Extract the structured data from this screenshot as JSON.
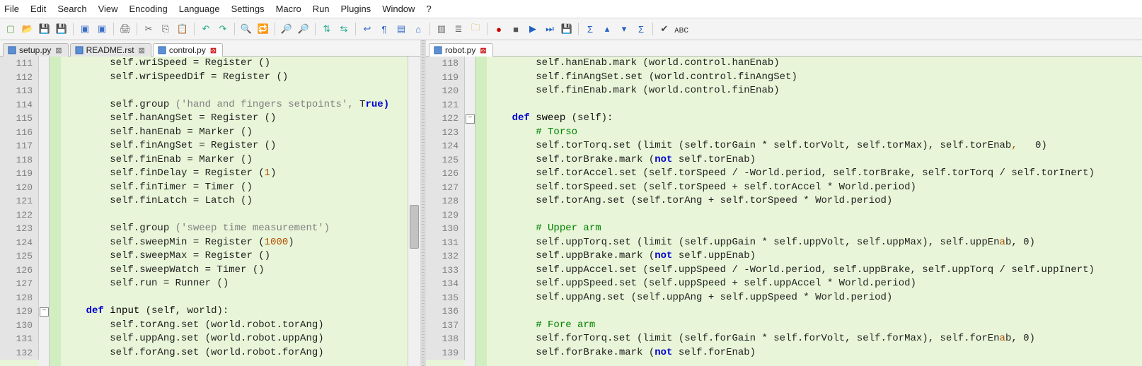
{
  "menu": [
    "File",
    "Edit",
    "Search",
    "View",
    "Encoding",
    "Language",
    "Settings",
    "Macro",
    "Run",
    "Plugins",
    "Window",
    "?"
  ],
  "toolbar_icons": [
    {
      "n": "new-file-icon",
      "c": "#6aa84f",
      "g": "▢"
    },
    {
      "n": "open-file-icon",
      "c": "#e0a030",
      "g": "📂"
    },
    {
      "n": "save-icon",
      "c": "#3a6ec8",
      "g": "💾"
    },
    {
      "n": "save-all-icon",
      "c": "#3a6ec8",
      "g": "💾"
    },
    {
      "n": "sep"
    },
    {
      "n": "close-icon",
      "c": "#3a6ec8",
      "g": "▣"
    },
    {
      "n": "close-all-icon",
      "c": "#3a6ec8",
      "g": "▣"
    },
    {
      "n": "sep"
    },
    {
      "n": "print-icon",
      "c": "#666",
      "g": "🖨"
    },
    {
      "n": "sep"
    },
    {
      "n": "cut-icon",
      "c": "#666",
      "g": "✂"
    },
    {
      "n": "copy-icon",
      "c": "#666",
      "g": "⎘"
    },
    {
      "n": "paste-icon",
      "c": "#666",
      "g": "📋"
    },
    {
      "n": "sep"
    },
    {
      "n": "undo-icon",
      "c": "#2a8",
      "g": "↶"
    },
    {
      "n": "redo-icon",
      "c": "#2a8",
      "g": "↷"
    },
    {
      "n": "sep"
    },
    {
      "n": "find-icon",
      "c": "#666",
      "g": "🔍"
    },
    {
      "n": "replace-icon",
      "c": "#666",
      "g": "🔁"
    },
    {
      "n": "sep"
    },
    {
      "n": "zoom-in-icon",
      "c": "#666",
      "g": "🔎"
    },
    {
      "n": "zoom-out-icon",
      "c": "#666",
      "g": "🔎"
    },
    {
      "n": "sep"
    },
    {
      "n": "sync-v-icon",
      "c": "#2a8",
      "g": "⇅"
    },
    {
      "n": "sync-h-icon",
      "c": "#2a8",
      "g": "⇆"
    },
    {
      "n": "sep"
    },
    {
      "n": "wordwrap-icon",
      "c": "#3a6ec8",
      "g": "↩"
    },
    {
      "n": "allchars-icon",
      "c": "#3a6ec8",
      "g": "¶"
    },
    {
      "n": "indent-guide-icon",
      "c": "#3a6ec8",
      "g": "▤"
    },
    {
      "n": "lang-icon",
      "c": "#3a6ec8",
      "g": "⌂"
    },
    {
      "n": "sep"
    },
    {
      "n": "doc-map-icon",
      "c": "#666",
      "g": "▥"
    },
    {
      "n": "func-list-icon",
      "c": "#666",
      "g": "≣"
    },
    {
      "n": "folder-view-icon",
      "c": "#e0a030",
      "g": "🗀"
    },
    {
      "n": "sep"
    },
    {
      "n": "record-macro-icon",
      "c": "#c00",
      "g": "●"
    },
    {
      "n": "stop-macro-icon",
      "c": "#555",
      "g": "■"
    },
    {
      "n": "play-macro-icon",
      "c": "#2060c0",
      "g": "▶"
    },
    {
      "n": "play-multi-icon",
      "c": "#2060c0",
      "g": "⏭"
    },
    {
      "n": "save-macro-icon",
      "c": "#2060c0",
      "g": "💾"
    },
    {
      "n": "sep"
    },
    {
      "n": "toggle-1-icon",
      "c": "#2060c0",
      "g": "Σ"
    },
    {
      "n": "toggle-2-icon",
      "c": "#2060c0",
      "g": "▴"
    },
    {
      "n": "toggle-3-icon",
      "c": "#2060c0",
      "g": "▾"
    },
    {
      "n": "toggle-4-icon",
      "c": "#2060c0",
      "g": "Σ"
    },
    {
      "n": "sep"
    },
    {
      "n": "spellcheck-icon",
      "c": "#444",
      "g": "✔"
    },
    {
      "n": "abc-icon",
      "c": "#444",
      "g": "ᴀʙᴄ"
    }
  ],
  "left": {
    "tabs": [
      {
        "label": "setup.py",
        "active": false,
        "saved": true
      },
      {
        "label": "README.rst",
        "active": false,
        "saved": true
      },
      {
        "label": "control.py",
        "active": true,
        "saved": false
      }
    ],
    "first_line": 111,
    "fold_minus_rows": [
      18
    ],
    "lines": [
      {
        "t": "        self.wriSpeed = Register ()"
      },
      {
        "t": "        self.wriSpeedDif = Register ()"
      },
      {
        "t": ""
      },
      {
        "t": "        self.group ('hand and fingers setpoints', True)",
        "str": [
          19,
          48
        ],
        "bool": [
          51,
          55
        ]
      },
      {
        "t": "        self.hanAngSet = Register ()"
      },
      {
        "t": "        self.hanEnab = Marker ()"
      },
      {
        "t": "        self.finAngSet = Register ()"
      },
      {
        "t": "        self.finEnab = Marker ()"
      },
      {
        "t": "        self.finDelay = Register (1)",
        "num": [
          34,
          35
        ]
      },
      {
        "t": "        self.finTimer = Timer ()"
      },
      {
        "t": "        self.finLatch = Latch ()"
      },
      {
        "t": ""
      },
      {
        "t": "        self.group ('sweep time measurement')",
        "str": [
          19,
          44
        ]
      },
      {
        "t": "        self.sweepMin = Register (1000)",
        "num": [
          34,
          38
        ]
      },
      {
        "t": "        self.sweepMax = Register ()"
      },
      {
        "t": "        self.sweepWatch = Timer ()"
      },
      {
        "t": "        self.run = Runner ()"
      },
      {
        "t": ""
      },
      {
        "t": "    def input (self, world):",
        "kw": [
          4,
          7
        ],
        "fn": [
          8,
          13
        ]
      },
      {
        "t": "        self.torAng.set (world.robot.torAng)"
      },
      {
        "t": "        self.uppAng.set (world.robot.uppAng)"
      },
      {
        "t": "        self.forAng.set (world.robot.forAng)"
      }
    ]
  },
  "right": {
    "tabs": [
      {
        "label": "robot.py",
        "active": true,
        "saved": false
      }
    ],
    "first_line": 118,
    "fold_minus_rows": [
      4
    ],
    "lines": [
      {
        "t": "        self.hanEnab.mark (world.control.hanEnab)"
      },
      {
        "t": "        self.finAngSet.set (world.control.finAngSet)"
      },
      {
        "t": "        self.finEnab.mark (world.control.finEnab)"
      },
      {
        "t": ""
      },
      {
        "t": "    def sweep (self):",
        "kw": [
          4,
          7
        ],
        "fn": [
          8,
          13
        ]
      },
      {
        "t": "        # Torso",
        "cm": [
          8,
          15
        ]
      },
      {
        "t": "        self.torTorq.set (limit (self.torGain * self.torVolt, self.torMax), self.torEnab,   0)",
        "num": [
          88,
          89
        ]
      },
      {
        "t": "        self.torBrake.mark (not self.torEnab)",
        "kw2": [
          28,
          31
        ]
      },
      {
        "t": "        self.torAccel.set (self.torSpeed / -World.period, self.torBrake, self.torTorq / self.torInert)"
      },
      {
        "t": "        self.torSpeed.set (self.torSpeed + self.torAccel * World.period)"
      },
      {
        "t": "        self.torAng.set (self.torAng + self.torSpeed * World.period)"
      },
      {
        "t": ""
      },
      {
        "t": "        # Upper arm",
        "cm": [
          8,
          19
        ]
      },
      {
        "t": "        self.uppTorq.set (limit (self.uppGain * self.uppVolt, self.uppMax), self.uppEnab, 0)",
        "num": [
          86,
          87
        ]
      },
      {
        "t": "        self.uppBrake.mark (not self.uppEnab)",
        "kw2": [
          28,
          31
        ]
      },
      {
        "t": "        self.uppAccel.set (self.uppSpeed / -World.period, self.uppBrake, self.uppTorq / self.uppInert)"
      },
      {
        "t": "        self.uppSpeed.set (self.uppSpeed + self.uppAccel * World.period)"
      },
      {
        "t": "        self.uppAng.set (self.uppAng + self.uppSpeed * World.period)"
      },
      {
        "t": ""
      },
      {
        "t": "        # Fore arm",
        "cm": [
          8,
          18
        ]
      },
      {
        "t": "        self.forTorq.set (limit (self.forGain * self.forVolt, self.forMax), self.forEnab, 0)",
        "num": [
          86,
          87
        ]
      },
      {
        "t": "        self.forBrake.mark (not self.forEnab)",
        "kw2": [
          28,
          31
        ]
      }
    ]
  },
  "colors": {
    "code_bg": "#E8F5D8",
    "gutter_bg": "#e4e4e4"
  }
}
